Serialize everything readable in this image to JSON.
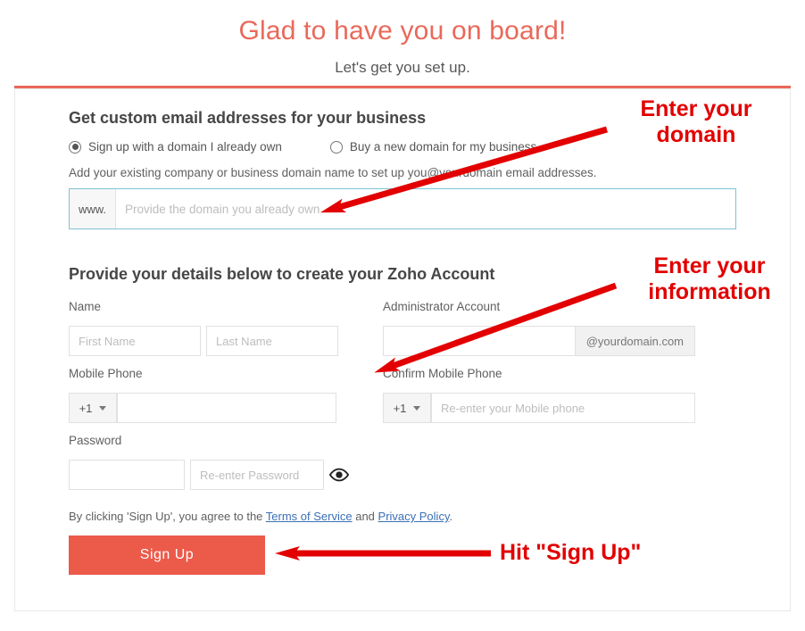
{
  "heading": {
    "title": "Glad to have you on board!",
    "subtitle": "Let's get you set up."
  },
  "section1": {
    "title": "Get custom email addresses for your business",
    "radio_own": "Sign up with a domain I already own",
    "radio_buy": "Buy a new domain for my business",
    "help": "Add your existing company or business domain name to set up you@yourdomain email addresses.",
    "prefix": "www.",
    "placeholder": "Provide the domain you already own"
  },
  "section2": {
    "title": "Provide your details below to create your Zoho Account",
    "labels": {
      "name": "Name",
      "admin": "Administrator Account",
      "mobile": "Mobile Phone",
      "confirm_mobile": "Confirm Mobile Phone",
      "password": "Password"
    },
    "placeholders": {
      "first": "First Name",
      "last": "Last Name",
      "reenter_mobile": "Re-enter your Mobile phone",
      "reenter_password": "Re-enter Password"
    },
    "admin_suffix": "@yourdomain.com",
    "phone_code": "+1"
  },
  "agree": {
    "prefix": "By clicking 'Sign Up', you agree to the ",
    "tos": "Terms of Service",
    "mid": " and ",
    "privacy": "Privacy Policy",
    "suffix": "."
  },
  "signup_label": "Sign Up",
  "annotations": {
    "a1_l1": "Enter your",
    "a1_l2": "domain",
    "a2_l1": "Enter your",
    "a2_l2": "information",
    "a3": "Hit \"Sign Up\""
  }
}
